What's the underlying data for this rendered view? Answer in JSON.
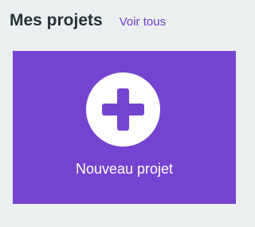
{
  "header": {
    "title": "Mes projets",
    "see_all_label": "Voir tous"
  },
  "new_project_card": {
    "label": "Nouveau projet",
    "icon": "plus-icon",
    "background_color": "#7444d0",
    "icon_color": "#7444d0",
    "icon_bg_color": "#ffffff"
  },
  "colors": {
    "page_background": "#eceff0",
    "title_color": "#263238",
    "link_color": "#6b3fc9"
  }
}
